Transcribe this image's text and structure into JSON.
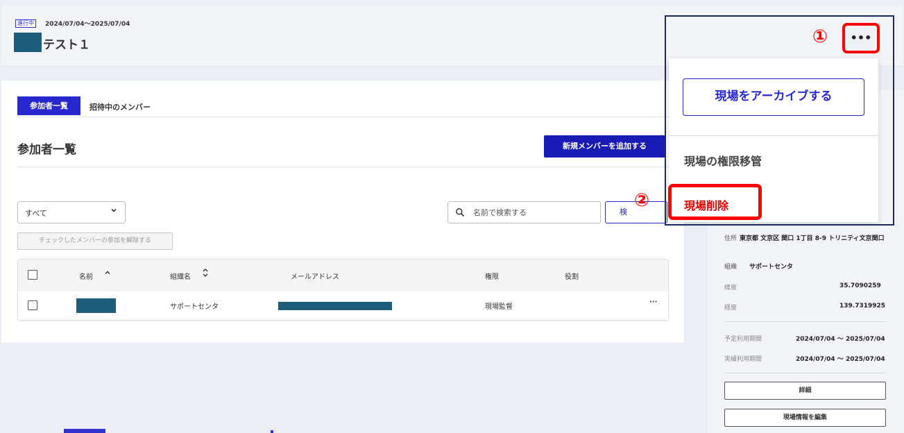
{
  "header": {
    "status_badge": "進行中",
    "period": "2024/07/04～2025/07/04",
    "title": "テスト１",
    "more_button": "•••"
  },
  "tabs": [
    {
      "label": "参加者一覧",
      "active": true
    },
    {
      "label": "招待中のメンバー",
      "active": false
    }
  ],
  "members": {
    "section_title": "参加者一覧",
    "add_button": "新規メンバーを追加する",
    "filter": {
      "value": "すべて",
      "chevron": "⌄"
    },
    "search": {
      "placeholder": "名前で検索する",
      "button_label": "検"
    },
    "unjoin_button": "チェックしたメンバーの参加を解除する",
    "columns": [
      "名前",
      "組織名",
      "メールアドレス",
      "権限",
      "役割"
    ],
    "sort_icons": {
      "name": "^",
      "org": "⌃⌄"
    },
    "rows": [
      {
        "organization": "サポートセンタ",
        "permission": "現場監督",
        "role": "",
        "menu": "···"
      }
    ]
  },
  "dropdown": {
    "archive": "現場をアーカイブする",
    "transfer": "現場の権限移管",
    "delete": "現場削除"
  },
  "annotations": {
    "marker1": "①",
    "marker2": "②"
  },
  "site_info": {
    "address_label": "住所",
    "address_value": "東京都 文京区 関口 1丁目 8-9 トリニティ文京関口",
    "org_label": "組織",
    "org_value": "サポートセンタ",
    "lat_label": "緯度",
    "lat_value": "35.7090259",
    "lng_label": "経度",
    "lng_value": "139.7319925",
    "planned_label": "予定利用期間",
    "planned_value": "2024/07/04 ～ 2025/07/04",
    "actual_label": "実績利用期間",
    "actual_value": "2024/07/04 ～ 2025/07/04",
    "detail_button": "詳細",
    "edit_button": "現場情報を編集"
  },
  "colors": {
    "brand": "#2828cf",
    "danger": "#e00000",
    "redaction": "#1d5c7a"
  }
}
